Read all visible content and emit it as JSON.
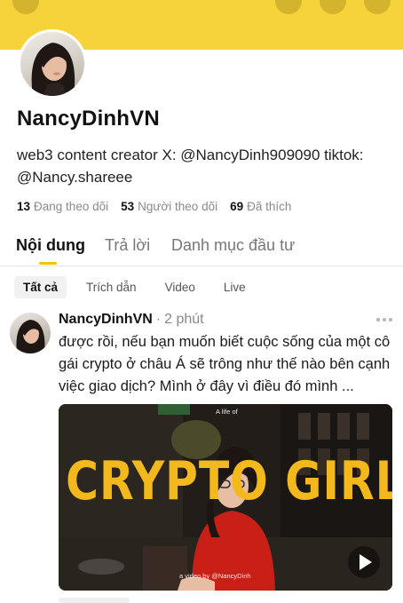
{
  "profile": {
    "display_name": "NancyDinhVN",
    "bio": "web3 content creator X: @NancyDinh909090 tiktok: @Nancy.shareee",
    "stats": [
      {
        "value": "13",
        "label": "Đang theo dõi"
      },
      {
        "value": "53",
        "label": "Người theo dõi"
      },
      {
        "value": "69",
        "label": "Đã thích"
      }
    ]
  },
  "tabs": [
    {
      "label": "Nội dung",
      "active": true
    },
    {
      "label": "Trả lời",
      "active": false
    },
    {
      "label": "Danh mục đầu tư",
      "active": false
    }
  ],
  "filters": [
    {
      "label": "Tất cả",
      "active": true
    },
    {
      "label": "Trích dẫn",
      "active": false
    },
    {
      "label": "Video",
      "active": false
    },
    {
      "label": "Live",
      "active": false
    }
  ],
  "post": {
    "author": "NancyDinhVN",
    "separator": "·",
    "time": "2 phút",
    "text": "được rồi, nếu bạn muốn biết cuộc sống của một cô gái crypto ở châu Á sẽ trông như thế nào bên cạnh việc giao dịch? Mình ở đây vì điều đó  mình ...",
    "video": {
      "cover_title": "CRYPTO GIRL",
      "cover_top_text": "A life of",
      "cover_credit": "a video by @NancyDinh"
    }
  },
  "colors": {
    "banner": "#f6d33a",
    "tab_indicator": "#f0c400",
    "cover_title": "#f2b81c",
    "muted_text": "#8a8a8a"
  },
  "icons": [
    "more-dots-icon",
    "play-icon"
  ]
}
